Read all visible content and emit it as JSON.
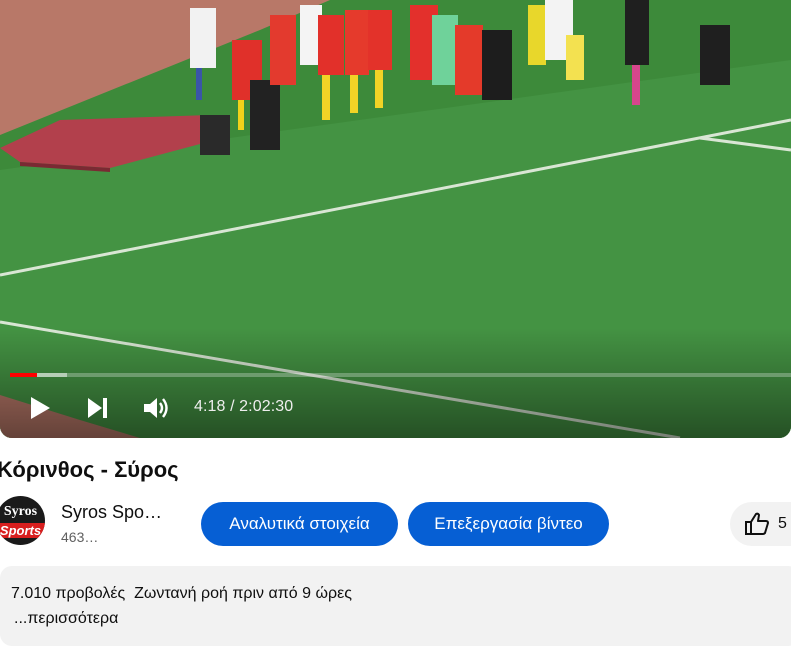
{
  "player": {
    "time_display": "4:18 / 2:02:30",
    "progress_fraction": 0.035,
    "buffered_fraction": 0.073,
    "play_icon": "play-icon",
    "next_icon": "skip-next-icon",
    "volume_icon": "volume-icon",
    "progress_color": "#ff0000"
  },
  "video": {
    "title": "Κόρινθος - Σύρος"
  },
  "channel": {
    "name": "Syros Spo…",
    "subscribers": "463…",
    "avatar_text_top": "Syros",
    "avatar_text_bottom": "Sports"
  },
  "actions": {
    "analytics_label": "Αναλυτικά στοιχεία",
    "edit_label": "Επεξεργασία βίντεο",
    "like_count": "5",
    "button_color": "#065fd4"
  },
  "description": {
    "views": "7.010 προβολές",
    "stream_info": "Ζωντανή ροή πριν από 9 ώρες",
    "more_label": "...περισσότερα"
  }
}
